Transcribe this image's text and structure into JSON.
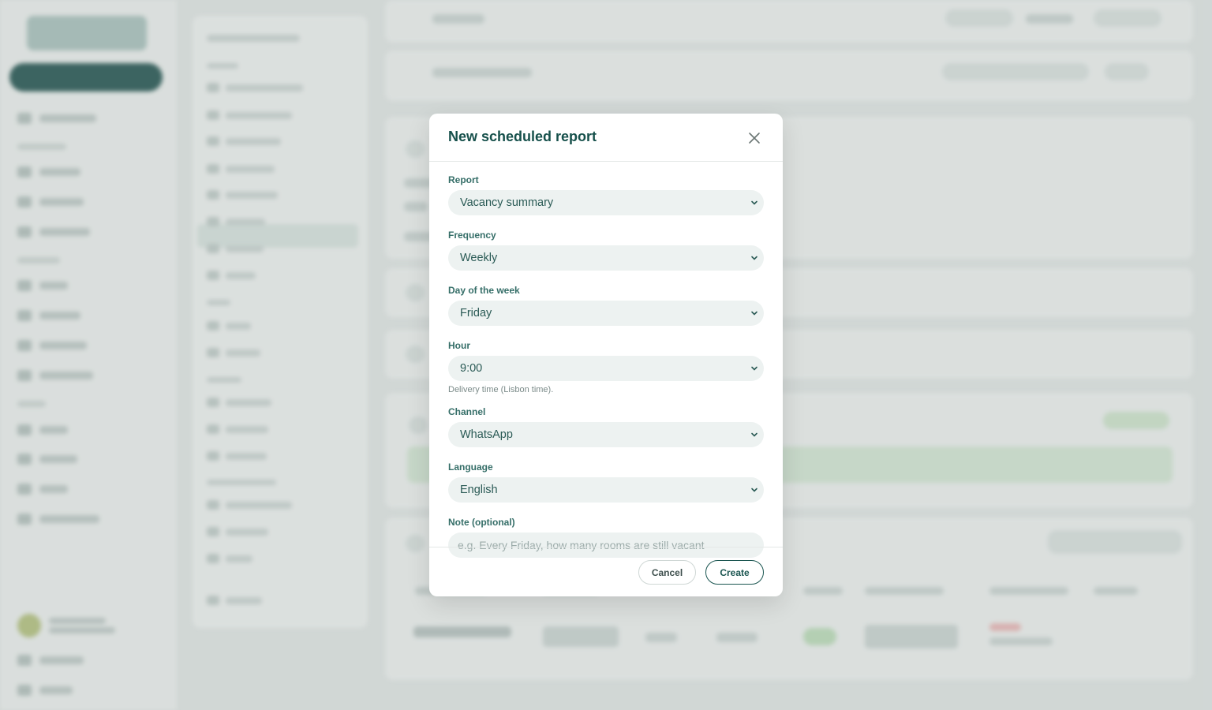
{
  "modal": {
    "title": "New scheduled report",
    "close_icon": "close-icon",
    "fields": {
      "report": {
        "label": "Report",
        "value": "Vacancy summary"
      },
      "frequency": {
        "label": "Frequency",
        "value": "Weekly"
      },
      "day_of_week": {
        "label": "Day of the week",
        "value": "Friday"
      },
      "hour": {
        "label": "Hour",
        "value": "9:00",
        "help": "Delivery time (Lisbon time)."
      },
      "channel": {
        "label": "Channel",
        "value": "WhatsApp"
      },
      "language": {
        "label": "Language",
        "value": "English"
      },
      "note": {
        "label": "Note (optional)",
        "value": "",
        "placeholder": "e.g. Every Friday, how many rooms are still vacant"
      }
    },
    "buttons": {
      "cancel": "Cancel",
      "create": "Create"
    }
  },
  "colors": {
    "title": "#16504b",
    "label": "#356e68",
    "input_bg": "#edf2f1",
    "primary": "#1a5550",
    "brand_dark": "#1a4d4a"
  }
}
